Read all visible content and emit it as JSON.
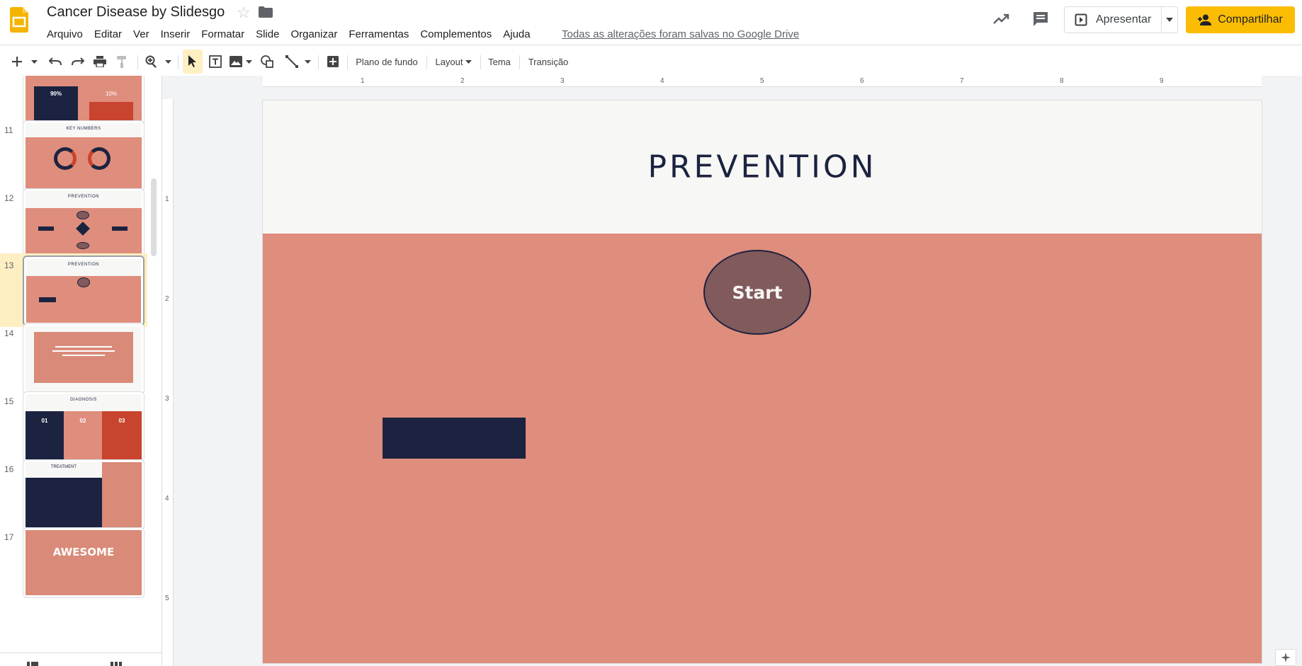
{
  "app": {
    "doc_title": "Cancer Disease by Slidesgo",
    "save_status": "Todas as alterações foram salvas no Google Drive",
    "brand_color": "#f4b400"
  },
  "menu": [
    "Arquivo",
    "Editar",
    "Ver",
    "Inserir",
    "Formatar",
    "Slide",
    "Organizar",
    "Ferramentas",
    "Complementos",
    "Ajuda"
  ],
  "header_buttons": {
    "present_label": "Apresentar",
    "share_label": "Compartilhar",
    "share_color": "#fbbc04"
  },
  "toolbar": {
    "background_label": "Plano de fundo",
    "layout_label": "Layout",
    "theme_label": "Tema",
    "transition_label": "Transição",
    "icons": [
      "new-slide-icon",
      "undo-icon",
      "redo-icon",
      "print-icon",
      "paint-format-icon",
      "zoom-icon",
      "select-icon",
      "text-box-icon",
      "image-icon",
      "shape-icon",
      "line-icon",
      "comment-add-icon"
    ]
  },
  "ruler": {
    "top_labels": [
      "1",
      "2",
      "3",
      "4",
      "5",
      "6",
      "7",
      "8",
      "9"
    ],
    "left_labels": [
      "1",
      "2",
      "3",
      "4",
      "5"
    ]
  },
  "filmstrip": {
    "slides": [
      {
        "num": "",
        "kind": "stats",
        "stat_a": "90%",
        "stat_b": "10%"
      },
      {
        "num": "11",
        "kind": "key-numbers",
        "title": "KEY NUMBERS"
      },
      {
        "num": "12",
        "kind": "flow",
        "title": "PREVENTION"
      },
      {
        "num": "13",
        "kind": "current",
        "title": "PREVENTION",
        "selected": true
      },
      {
        "num": "14",
        "kind": "quote"
      },
      {
        "num": "15",
        "kind": "diagnosis",
        "title": "DIAGNOSIS",
        "cols": [
          "01",
          "02",
          "03"
        ]
      },
      {
        "num": "16",
        "kind": "treatment",
        "title": "TREATMENT"
      },
      {
        "num": "17",
        "kind": "awesome",
        "title": "AWESOME"
      }
    ]
  },
  "slide": {
    "title": "PREVENTION",
    "start_label": "Start",
    "colors": {
      "background": "#df8d7c",
      "header_band": "#f7f7f5",
      "navy": "#1c2340",
      "node_fill": "#815a5c"
    }
  }
}
